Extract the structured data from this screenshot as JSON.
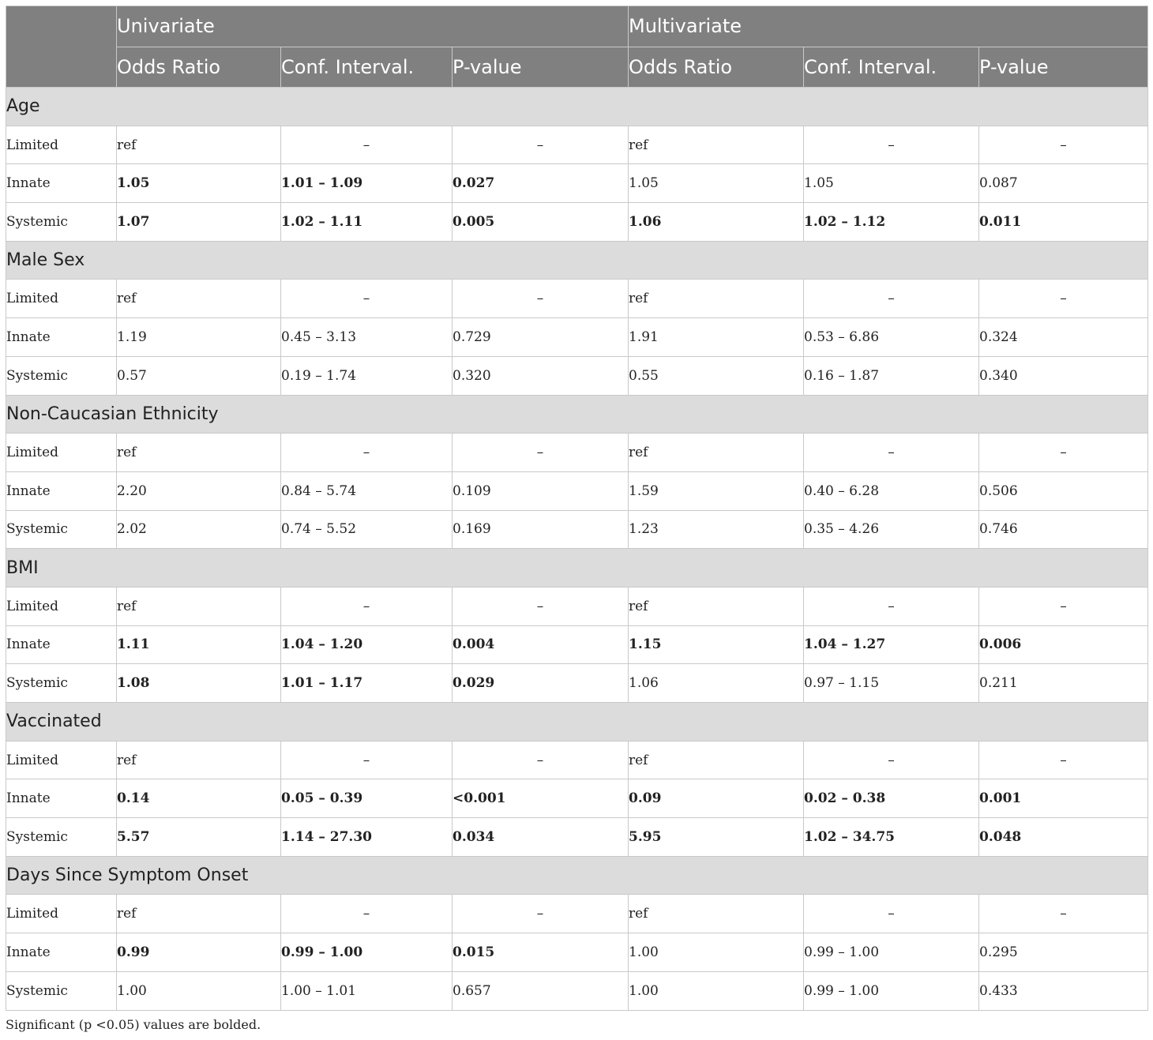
{
  "header": {
    "groups": [
      "Univariate",
      "Multivariate"
    ],
    "columns": [
      "Odds Ratio",
      "Conf. Interval.",
      "P-value",
      "Odds Ratio",
      "Conf. Interval.",
      "P-value"
    ]
  },
  "sections": [
    {
      "title": "Age",
      "rows": [
        {
          "label": "Limited",
          "cells": [
            "ref",
            "–",
            "–",
            "ref",
            "–",
            "–"
          ],
          "bold": [
            false,
            false,
            false,
            false,
            false,
            false
          ]
        },
        {
          "label": "Innate",
          "cells": [
            "1.05",
            "1.01 – 1.09",
            "0.027",
            "1.05",
            "1.05",
            "0.087"
          ],
          "bold": [
            true,
            true,
            true,
            false,
            false,
            false
          ]
        },
        {
          "label": "Systemic",
          "cells": [
            "1.07",
            "1.02 – 1.11",
            "0.005",
            "1.06",
            "1.02 – 1.12",
            "0.011"
          ],
          "bold": [
            true,
            true,
            true,
            true,
            true,
            true
          ]
        }
      ]
    },
    {
      "title": "Male Sex",
      "rows": [
        {
          "label": "Limited",
          "cells": [
            "ref",
            "–",
            "–",
            "ref",
            "–",
            "–"
          ],
          "bold": [
            false,
            false,
            false,
            false,
            false,
            false
          ]
        },
        {
          "label": "Innate",
          "cells": [
            "1.19",
            "0.45 – 3.13",
            "0.729",
            "1.91",
            "0.53 – 6.86",
            "0.324"
          ],
          "bold": [
            false,
            false,
            false,
            false,
            false,
            false
          ]
        },
        {
          "label": "Systemic",
          "cells": [
            "0.57",
            "0.19 – 1.74",
            "0.320",
            "0.55",
            "0.16 – 1.87",
            "0.340"
          ],
          "bold": [
            false,
            false,
            false,
            false,
            false,
            false
          ]
        }
      ]
    },
    {
      "title": "Non-Caucasian Ethnicity",
      "rows": [
        {
          "label": "Limited",
          "cells": [
            "ref",
            "–",
            "–",
            "ref",
            "–",
            "–"
          ],
          "bold": [
            false,
            false,
            false,
            false,
            false,
            false
          ]
        },
        {
          "label": "Innate",
          "cells": [
            "2.20",
            "0.84 – 5.74",
            "0.109",
            "1.59",
            "0.40 – 6.28",
            "0.506"
          ],
          "bold": [
            false,
            false,
            false,
            false,
            false,
            false
          ]
        },
        {
          "label": "Systemic",
          "cells": [
            "2.02",
            "0.74 – 5.52",
            "0.169",
            "1.23",
            "0.35 – 4.26",
            "0.746"
          ],
          "bold": [
            false,
            false,
            false,
            false,
            false,
            false
          ]
        }
      ]
    },
    {
      "title": "BMI",
      "rows": [
        {
          "label": "Limited",
          "cells": [
            "ref",
            "–",
            "–",
            "ref",
            "–",
            "–"
          ],
          "bold": [
            false,
            false,
            false,
            false,
            false,
            false
          ]
        },
        {
          "label": "Innate",
          "cells": [
            "1.11",
            "1.04 – 1.20",
            "0.004",
            "1.15",
            "1.04 – 1.27",
            "0.006"
          ],
          "bold": [
            true,
            true,
            true,
            true,
            true,
            true
          ]
        },
        {
          "label": "Systemic",
          "cells": [
            "1.08",
            "1.01 – 1.17",
            "0.029",
            "1.06",
            "0.97 – 1.15",
            "0.211"
          ],
          "bold": [
            true,
            true,
            true,
            false,
            false,
            false
          ]
        }
      ]
    },
    {
      "title": "Vaccinated",
      "rows": [
        {
          "label": "Limited",
          "cells": [
            "ref",
            "–",
            "–",
            "ref",
            "–",
            "–"
          ],
          "bold": [
            false,
            false,
            false,
            false,
            false,
            false
          ]
        },
        {
          "label": "Innate",
          "cells": [
            "0.14",
            "0.05 – 0.39",
            "<0.001",
            "0.09",
            "0.02 – 0.38",
            "0.001"
          ],
          "bold": [
            true,
            true,
            true,
            true,
            true,
            true
          ]
        },
        {
          "label": "Systemic",
          "cells": [
            "5.57",
            "1.14 – 27.30",
            "0.034",
            "5.95",
            "1.02 – 34.75",
            "0.048"
          ],
          "bold": [
            true,
            true,
            true,
            true,
            true,
            true
          ]
        }
      ]
    },
    {
      "title": "Days Since Symptom Onset",
      "rows": [
        {
          "label": "Limited",
          "cells": [
            "ref",
            "–",
            "–",
            "ref",
            "–",
            "–"
          ],
          "bold": [
            false,
            false,
            false,
            false,
            false,
            false
          ]
        },
        {
          "label": "Innate",
          "cells": [
            "0.99",
            "0.99 – 1.00",
            "0.015",
            "1.00",
            "0.99 – 1.00",
            "0.295"
          ],
          "bold": [
            true,
            true,
            true,
            false,
            false,
            false
          ]
        },
        {
          "label": "Systemic",
          "cells": [
            "1.00",
            "1.00 – 1.01",
            "0.657",
            "1.00",
            "0.99 – 1.00",
            "0.433"
          ],
          "bold": [
            false,
            false,
            false,
            false,
            false,
            false
          ]
        }
      ]
    }
  ],
  "footnote": "Significant (p <0.05) values are bolded."
}
